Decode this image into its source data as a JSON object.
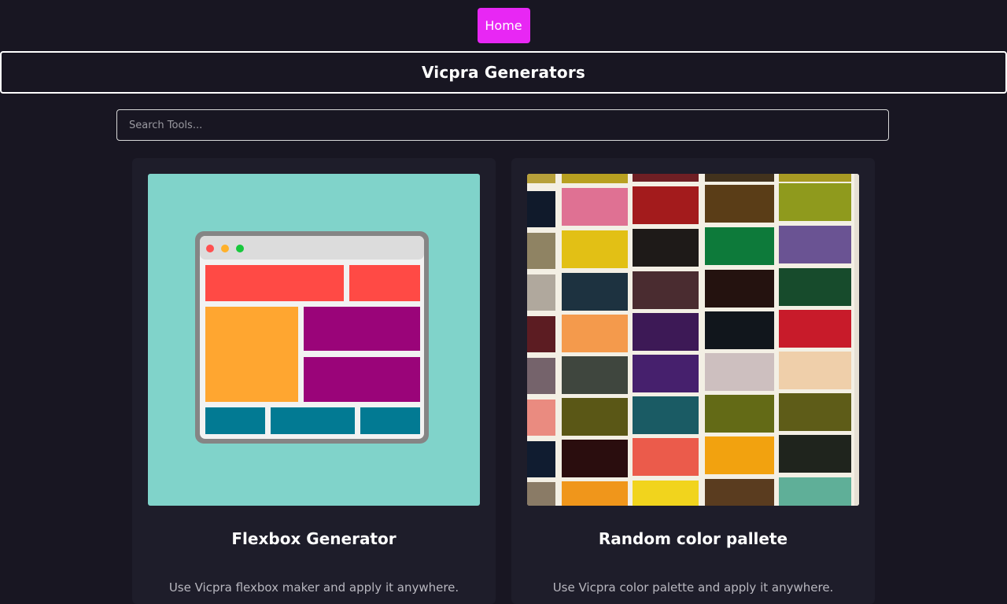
{
  "nav": {
    "home_label": "Home",
    "accent_color": "#e827f4"
  },
  "header": {
    "title": "Vicpra Generators"
  },
  "search": {
    "placeholder": "Search Tools...",
    "value": ""
  },
  "cards": [
    {
      "title": "Flexbox Generator",
      "description": "Use Vicpra flexbox maker and apply it anywhere.",
      "image": "flexbox-layout-illustration"
    },
    {
      "title": "Random color pallete",
      "description": "Use Vicpra color palette and apply it anywhere.",
      "image": "color-swatch-grid-photo"
    }
  ]
}
